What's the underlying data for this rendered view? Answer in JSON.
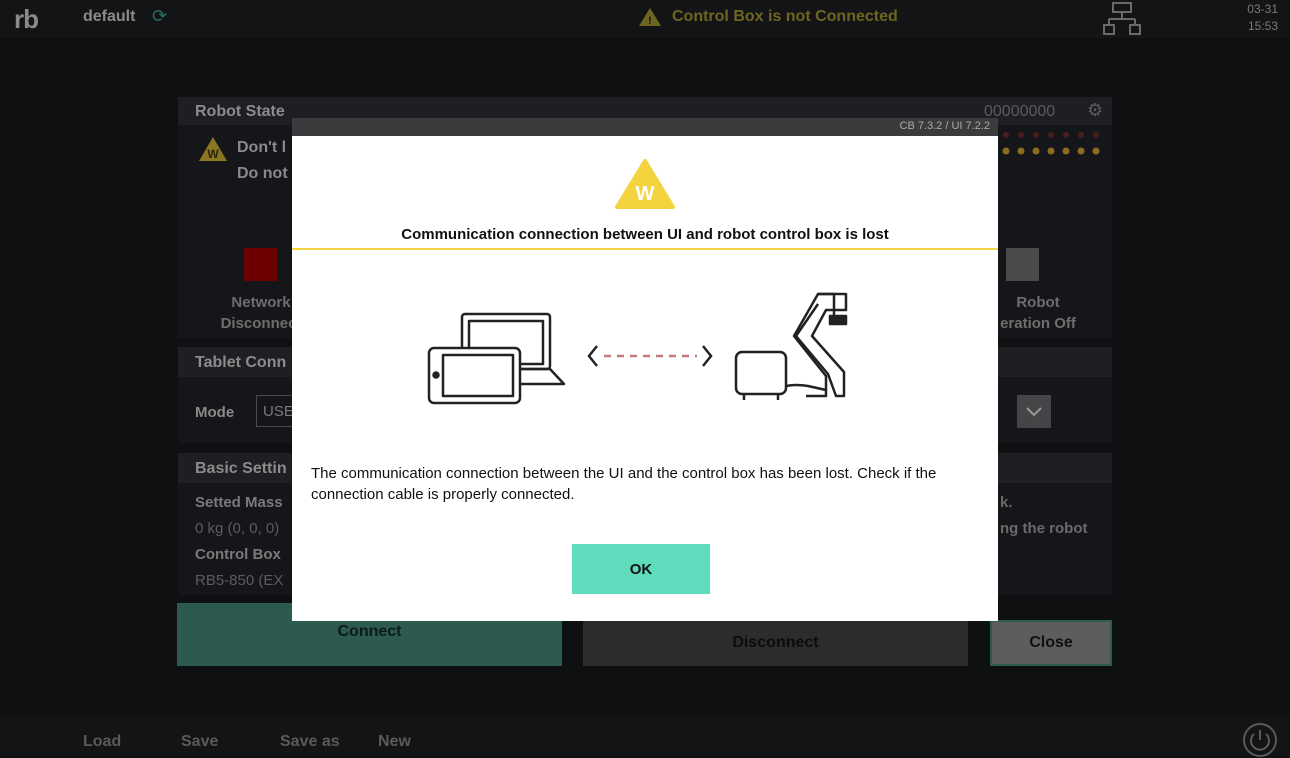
{
  "topbar": {
    "logo": "rb",
    "project_name": "default",
    "status_message": "Control Box is not Connected",
    "date": "03-31",
    "time": "15:53"
  },
  "robot_state": {
    "title": "Robot State",
    "serial": "00000000",
    "warning_line1": "Don't l",
    "warning_line2": "Do not",
    "network_label_line1": "Network",
    "network_label_line2": "Disconnect",
    "operation_label_line1": "Robot",
    "operation_label_line2": "eration Off",
    "colors": {
      "network": "#b30000",
      "operation": "#8a8a8a",
      "led_red": "#6e2323",
      "led_yellow": "#c69a2c"
    }
  },
  "tablet_connection": {
    "title": "Tablet Conn",
    "mode_label": "Mode",
    "mode_value": "USE"
  },
  "basic_settings": {
    "title": "Basic Settin",
    "mass_label": "Setted Mass",
    "mass_value": "0 kg (0, 0, 0)",
    "control_box_label": "Control Box",
    "control_box_value": "RB5-850 (EX",
    "right_text_1": "k.",
    "right_text_2": "ng the robot"
  },
  "buttons": {
    "connect": "Connect",
    "disconnect": "Disconnect",
    "close": "Close"
  },
  "bottombar": {
    "items": [
      "Load",
      "Save",
      "Save as",
      "New"
    ]
  },
  "modal": {
    "version": "CB 7.3.2 / UI 7.2.2",
    "warning_badge": "W",
    "title": "Communication connection between UI and robot control box is lost",
    "message": "The communication connection between the UI and the control box has been lost. Check if the connection cable is properly connected.",
    "ok": "OK",
    "colors": {
      "warning": "#f3d43f",
      "ok_button": "#5edcbd",
      "dashed_line": "#c47a7a"
    }
  }
}
